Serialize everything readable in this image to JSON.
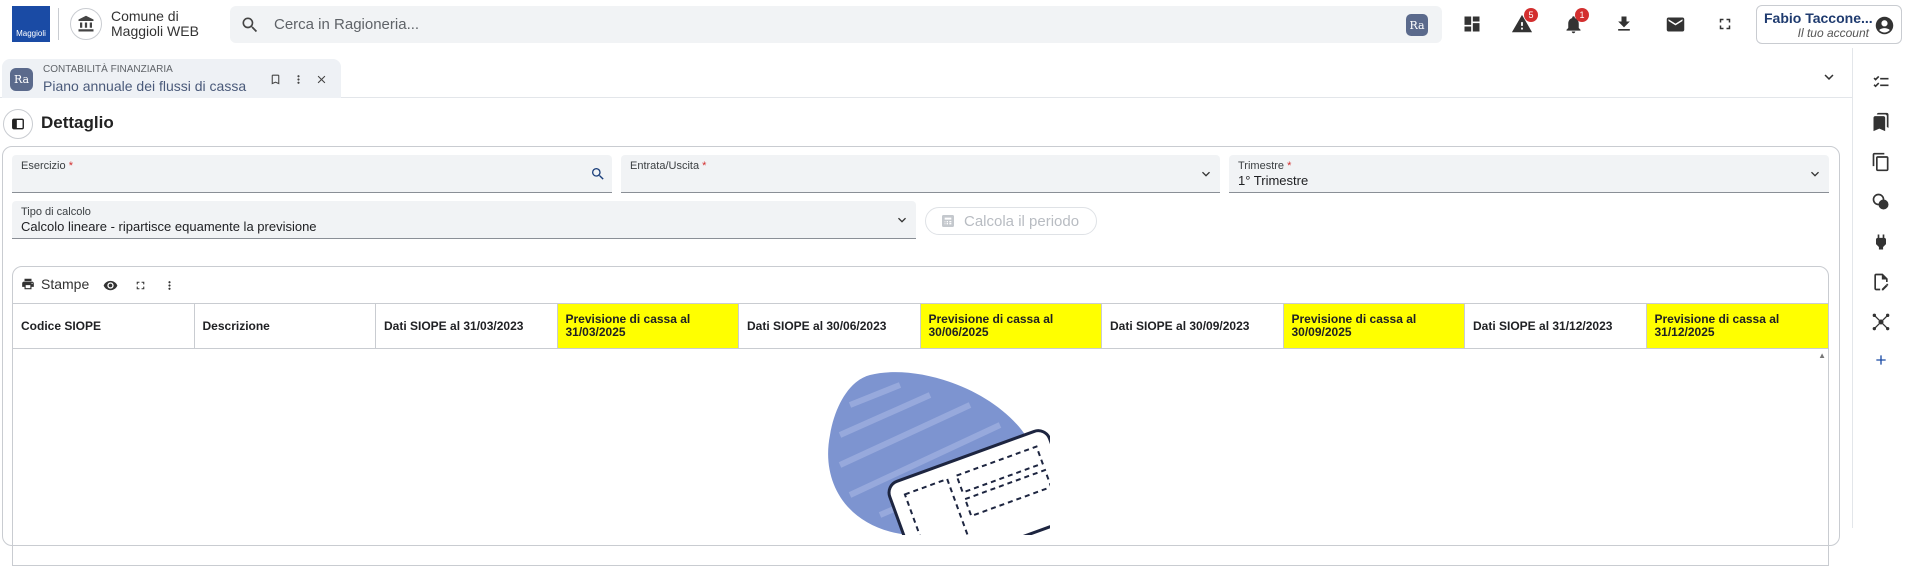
{
  "brand": {
    "logo_text": "Maggioli"
  },
  "comune": {
    "name": "Comune di Maggioli WEB"
  },
  "search": {
    "placeholder": "Cerca in Ragioneria...",
    "app_badge": "Ra"
  },
  "notifications": {
    "warnings_count": "5",
    "alerts_count": "1"
  },
  "account": {
    "name": "Fabio Taccone...",
    "subtitle": "Il tuo account"
  },
  "tab": {
    "badge": "Ra",
    "category": "CONTABILITÀ FINANZIARIA",
    "title": "Piano annuale dei flussi di cassa"
  },
  "detail": {
    "title": "Dettaglio"
  },
  "form": {
    "esercizio": {
      "label": "Esercizio",
      "value": ""
    },
    "entrata_uscita": {
      "label": "Entrata/Uscita",
      "value": ""
    },
    "trimestre": {
      "label": "Trimestre",
      "value": "1° Trimestre"
    },
    "tipo_calcolo": {
      "label": "Tipo di calcolo",
      "value": "Calcolo lineare - ripartisce equamente la previsione"
    },
    "required_mark": "*",
    "calc_button": "Calcola il periodo"
  },
  "grid": {
    "toolbar": {
      "print_label": "Stampe"
    },
    "highlight_color": "#ffff00",
    "columns": [
      {
        "label": "Codice SIOPE",
        "highlight": false
      },
      {
        "label": "Descrizione",
        "highlight": false
      },
      {
        "label": "Dati SIOPE al 31/03/2023",
        "highlight": false
      },
      {
        "label": "Previsione di cassa al 31/03/2025",
        "highlight": true
      },
      {
        "label": "Dati SIOPE al 30/06/2023",
        "highlight": false
      },
      {
        "label": "Previsione di cassa al 30/06/2025",
        "highlight": true
      },
      {
        "label": "Dati SIOPE al 30/09/2023",
        "highlight": false
      },
      {
        "label": "Previsione di cassa al 30/09/2025",
        "highlight": true
      },
      {
        "label": "Dati SIOPE al 31/12/2023",
        "highlight": false
      },
      {
        "label": "Previsione di cassa al 31/12/2025",
        "highlight": true
      }
    ]
  },
  "rail_icons": [
    "checklist-icon",
    "bookmarks-icon",
    "clipboard-icon",
    "coins-icon",
    "plug-icon",
    "document-edit-icon",
    "network-icon",
    "add-icon"
  ]
}
